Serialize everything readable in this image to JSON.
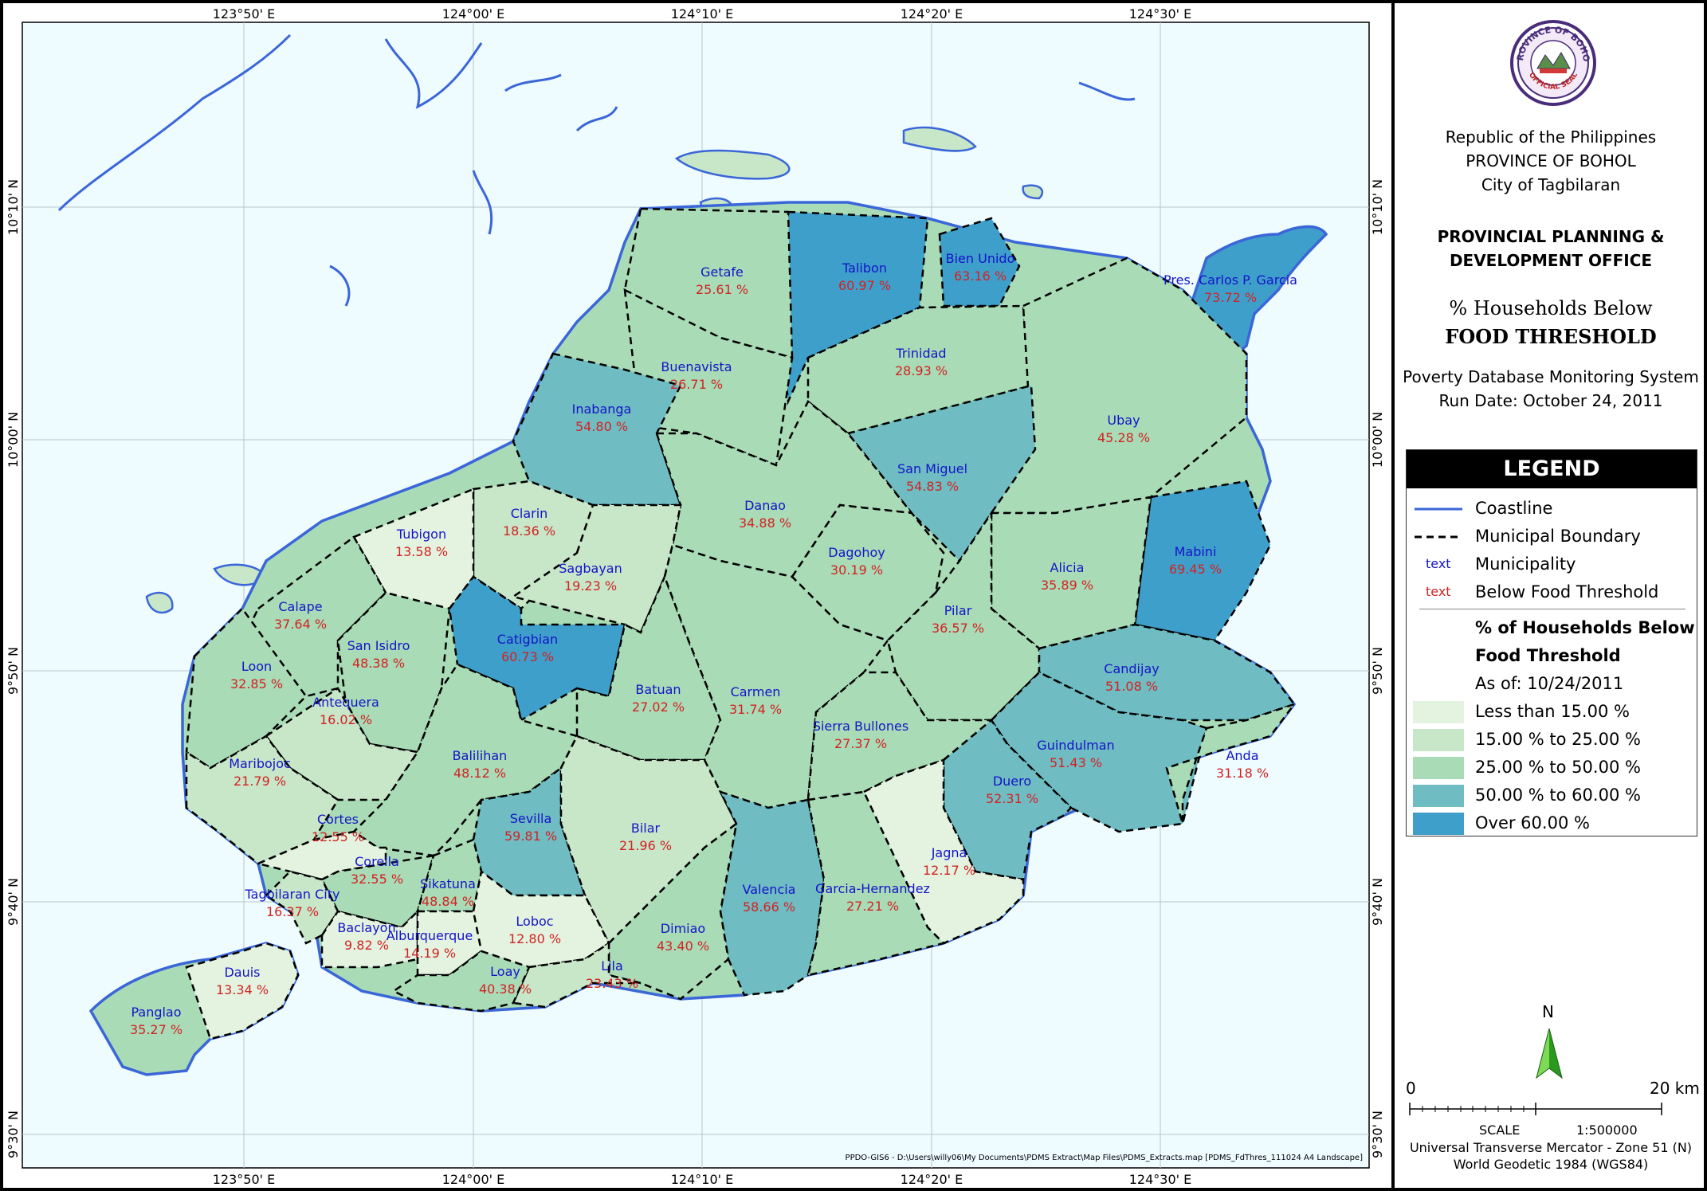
{
  "header": {
    "line1": "Republic of the Philippines",
    "line2": "PROVINCE OF BOHOL",
    "line3": "City of Tagbilaran",
    "office1": "PROVINCIAL PLANNING &",
    "office2": "DEVELOPMENT OFFICE",
    "title1": "% Households Below",
    "title2": "FOOD THRESHOLD",
    "system": "Poverty Database Monitoring System",
    "run_date": "Run Date: October 24, 2011"
  },
  "seal": {
    "top_text": "PROVINCE OF BOHOL",
    "bottom_text": "OFFICIAL SEAL",
    "icon": "seal-icon"
  },
  "legend": {
    "title": "LEGEND",
    "coastline": "Coastline",
    "boundary": "Municipal Boundary",
    "text_sample": "text",
    "municipality": "Municipality",
    "below": "Below Food Threshold",
    "sub1": "% of Households Below",
    "sub2": "Food Threshold",
    "as_of": "As of: 10/24/2011",
    "classes": [
      {
        "label": "Less than 15.00 %",
        "color": "#e4f3e0"
      },
      {
        "label": "15.00 % to 25.00 %",
        "color": "#c8e6c8"
      },
      {
        "label": "25.00 % to 50.00 %",
        "color": "#a9dbb6"
      },
      {
        "label": "50.00 % to 60.00 %",
        "color": "#6fbcc2"
      },
      {
        "label": "Over 60.00 %",
        "color": "#3f9fcb"
      }
    ],
    "coast_color": "#3a66d8",
    "name_color": "#1414c8",
    "value_color": "#d22323"
  },
  "north": "N",
  "scale": {
    "start": "0",
    "end": "20 km",
    "label": "SCALE",
    "ratio": "1:500000"
  },
  "projection1": "Universal Transverse Mercator - Zone 51 (N)",
  "projection2": "World Geodetic 1984 (WGS84)",
  "filepath": "PPDO-GIS6 - D:\\Users\\willy06\\My Documents\\PDMS Extract\\Map Files\\PDMS_Extracts.map [PDMS_FdThres_111024 A4 Landscape]",
  "ticks": {
    "top": [
      "123°50' E",
      "124°00' E",
      "124°10' E",
      "124°20' E",
      "124°30' E"
    ],
    "left": [
      "10°10' N",
      "10°00' N",
      "9°50' N",
      "9°40' N",
      "9°30' N"
    ]
  },
  "municipalities": [
    {
      "name": "Getafe",
      "value": "25.61 %"
    },
    {
      "name": "Talibon",
      "value": "60.97 %"
    },
    {
      "name": "Bien Unido",
      "value": "63.16 %"
    },
    {
      "name": "Pres. Carlos P. Garcia",
      "value": "73.72 %"
    },
    {
      "name": "Buenavista",
      "value": "26.71 %"
    },
    {
      "name": "Trinidad",
      "value": "28.93 %"
    },
    {
      "name": "Inabanga",
      "value": "54.80 %"
    },
    {
      "name": "Ubay",
      "value": "45.28 %"
    },
    {
      "name": "San Miguel",
      "value": "54.83 %"
    },
    {
      "name": "Clarin",
      "value": "18.36 %"
    },
    {
      "name": "Danao",
      "value": "34.88 %"
    },
    {
      "name": "Tubigon",
      "value": "13.58 %"
    },
    {
      "name": "Sagbayan",
      "value": "19.23 %"
    },
    {
      "name": "Dagohoy",
      "value": "30.19 %"
    },
    {
      "name": "Mabini",
      "value": "69.45 %"
    },
    {
      "name": "Alicia",
      "value": "35.89 %"
    },
    {
      "name": "Calape",
      "value": "37.64 %"
    },
    {
      "name": "San Isidro",
      "value": "48.38 %"
    },
    {
      "name": "Catigbian",
      "value": "60.73 %"
    },
    {
      "name": "Pilar",
      "value": "36.57 %"
    },
    {
      "name": "Loon",
      "value": "32.85 %"
    },
    {
      "name": "Batuan",
      "value": "27.02 %"
    },
    {
      "name": "Carmen",
      "value": "31.74 %"
    },
    {
      "name": "Candijay",
      "value": "51.08 %"
    },
    {
      "name": "Antequera",
      "value": "16.02 %"
    },
    {
      "name": "Sierra Bullones",
      "value": "27.37 %"
    },
    {
      "name": "Maribojoc",
      "value": "21.79 %"
    },
    {
      "name": "Balilihan",
      "value": "48.12 %"
    },
    {
      "name": "Guindulman",
      "value": "51.43 %"
    },
    {
      "name": "Anda",
      "value": "31.18 %"
    },
    {
      "name": "Duero",
      "value": "52.31 %"
    },
    {
      "name": "Cortes",
      "value": "12.55 %"
    },
    {
      "name": "Sevilla",
      "value": "59.81 %"
    },
    {
      "name": "Bilar",
      "value": "21.96 %"
    },
    {
      "name": "Jagna",
      "value": "12.17 %"
    },
    {
      "name": "Corella",
      "value": "32.55 %"
    },
    {
      "name": "Sikatuna",
      "value": "48.84 %"
    },
    {
      "name": "Tagbilaran City",
      "value": "16.37 %"
    },
    {
      "name": "Valencia",
      "value": "58.66 %"
    },
    {
      "name": "Garcia-Hernandez",
      "value": "27.21 %"
    },
    {
      "name": "Loboc",
      "value": "12.80 %"
    },
    {
      "name": "Baclayon",
      "value": "9.82 %"
    },
    {
      "name": "Alburquerque",
      "value": "14.19 %"
    },
    {
      "name": "Dimiao",
      "value": "43.40 %"
    },
    {
      "name": "Dauis",
      "value": "13.34 %"
    },
    {
      "name": "Lila",
      "value": "23.43 %"
    },
    {
      "name": "Loay",
      "value": "40.38 %"
    },
    {
      "name": "Panglao",
      "value": "35.27 %"
    }
  ]
}
